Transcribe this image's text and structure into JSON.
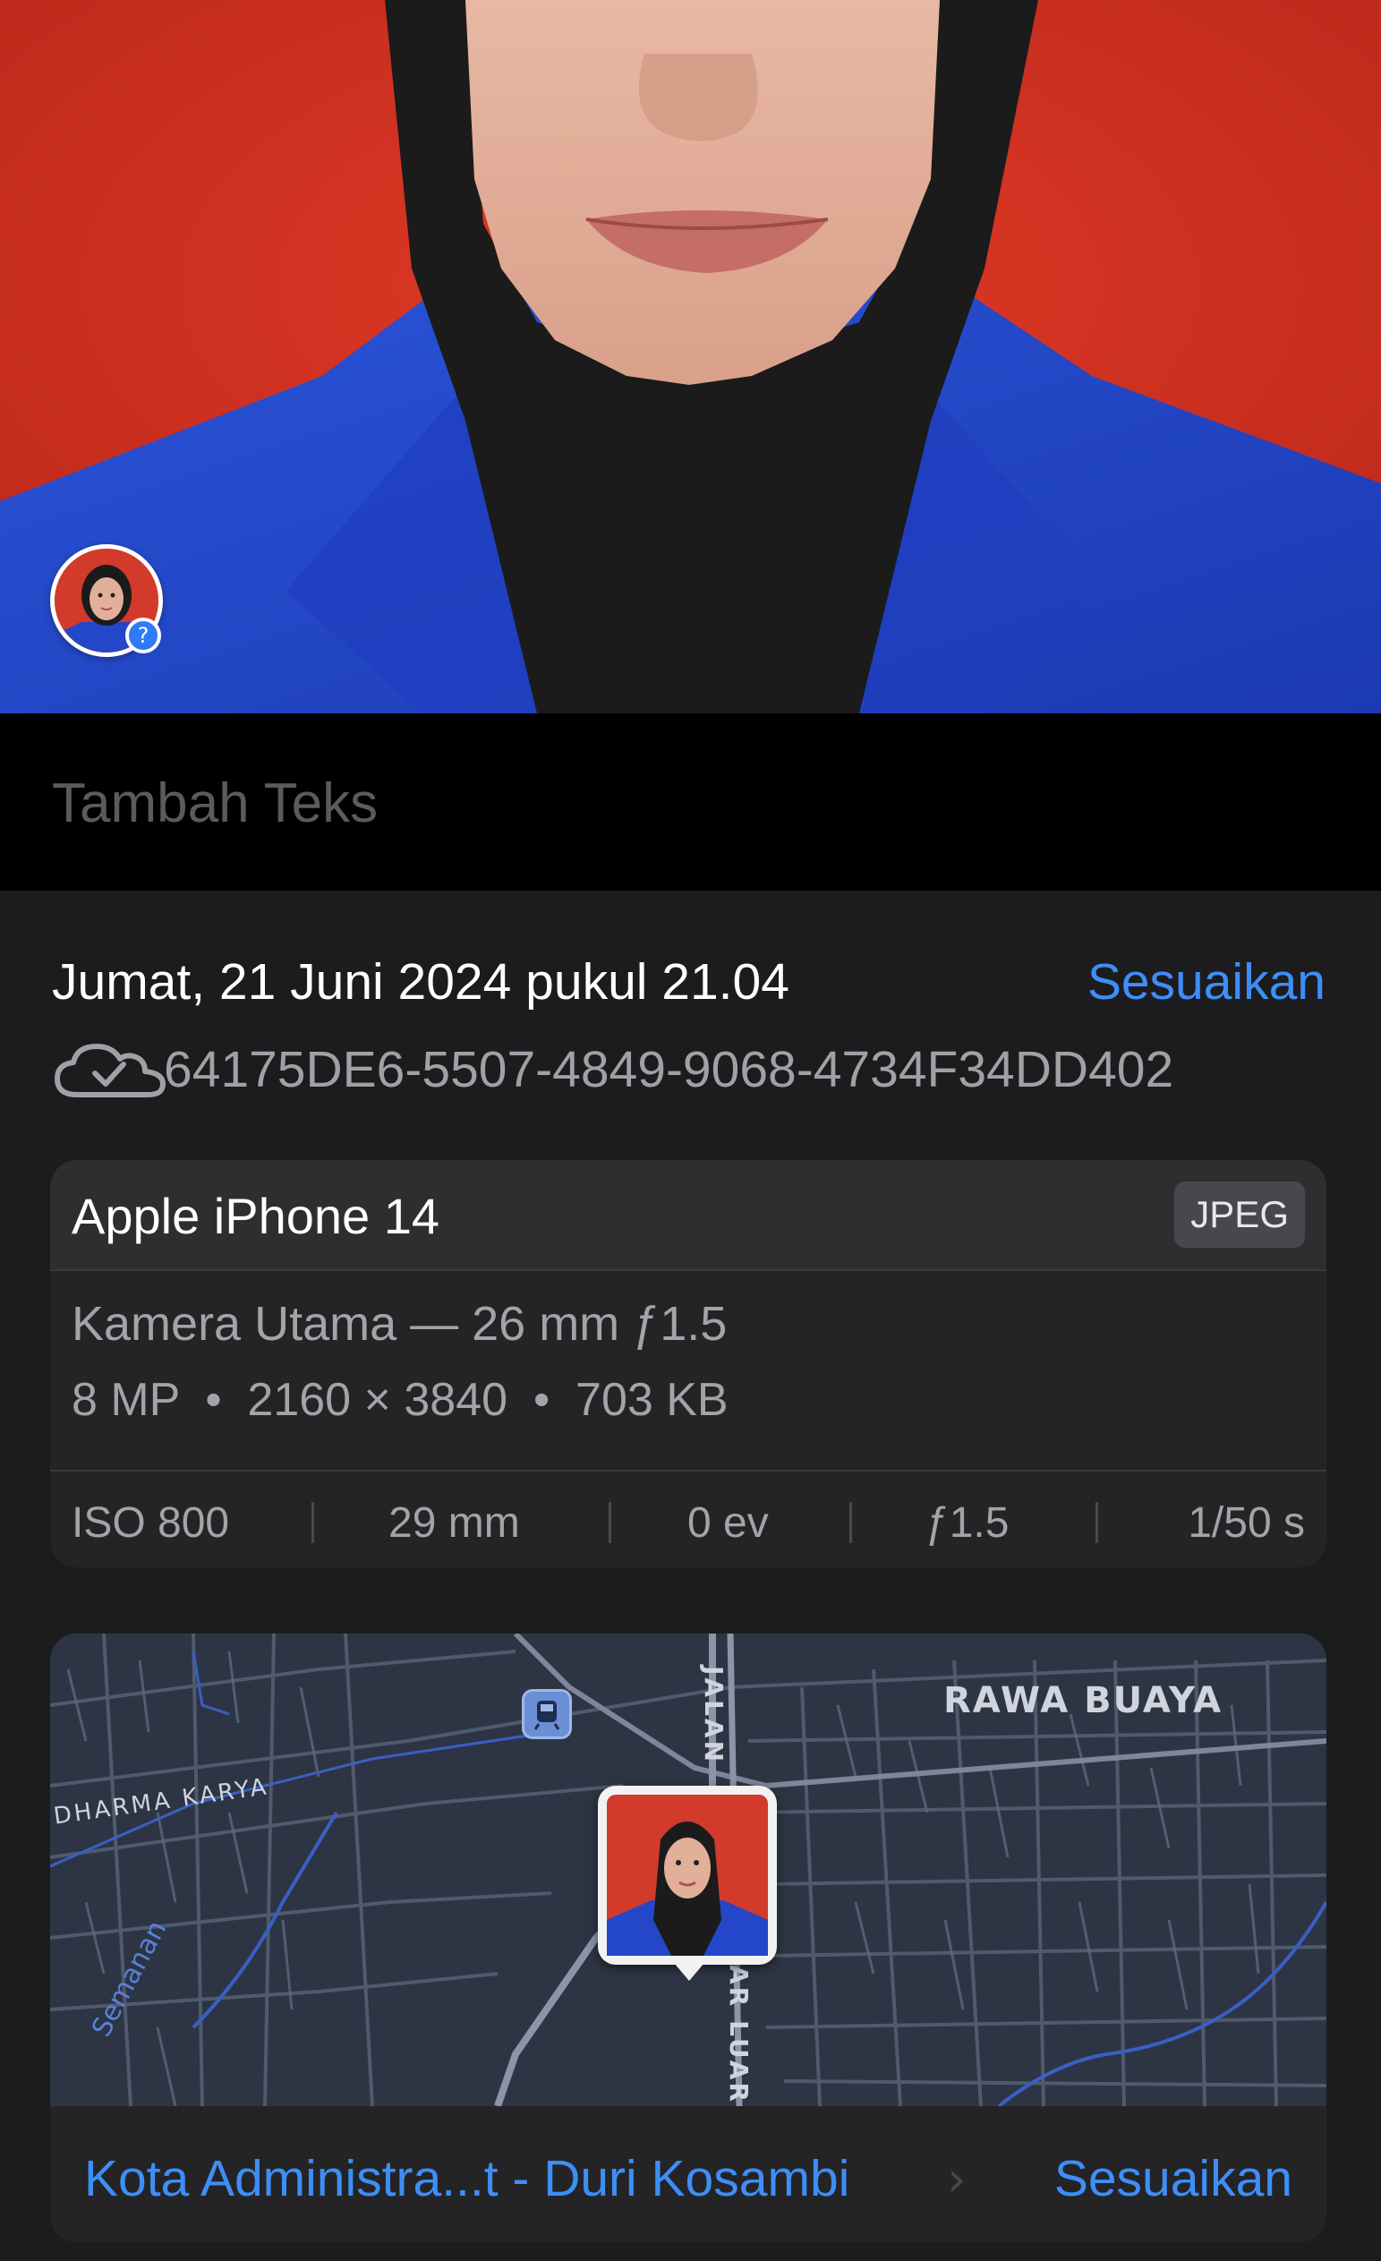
{
  "caption": {
    "placeholder": "Tambah Teks"
  },
  "info": {
    "date": "Jumat, 21 Juni 2024 pukul 21.04",
    "adjust_label": "Sesuaikan",
    "cloud_icon": "cloud-check-icon",
    "identifier": "64175DE6-5507-4849-9068-4734F34DD402"
  },
  "camera": {
    "device": "Apple iPhone 14",
    "format": "JPEG",
    "lens": "Kamera Utama — 26 mm ƒ1.5",
    "specs": "8 MP  •  2160 × 3840  •  703 KB",
    "exif": {
      "iso": "ISO 800",
      "focal": "29 mm",
      "ev": "0 ev",
      "aperture": "ƒ1.5",
      "shutter": "1/50 s"
    }
  },
  "map": {
    "labels": {
      "rawa_buaya": "RAWA BUAYA",
      "dharma_karya": "DHARMA KARYA",
      "semanan": "Semanan",
      "jalan": "JALAN",
      "ar_luar": "AR LUAR"
    },
    "location": "Kota Administra...t - Duri Kosambi",
    "adjust_label": "Sesuaikan"
  },
  "colors": {
    "accent": "#3e8ef7",
    "background_red": "#d2301f",
    "jacket_blue": "#2446c8"
  }
}
